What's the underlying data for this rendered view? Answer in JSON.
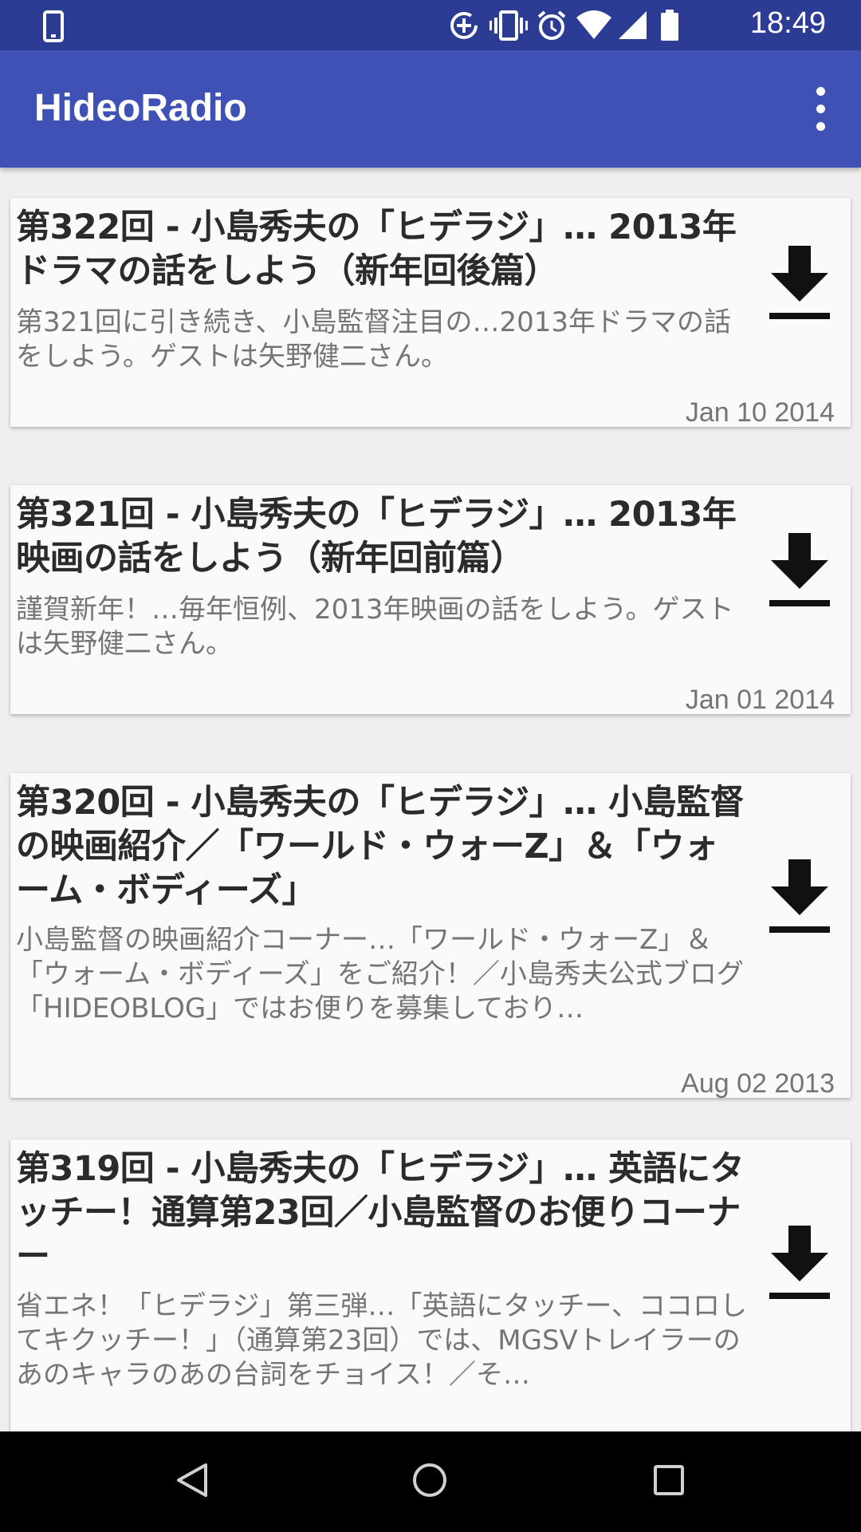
{
  "status_bar": {
    "time": "18:49",
    "icons": [
      "phone-icon",
      "data-saver-icon",
      "vibrate-icon",
      "alarm-icon",
      "wifi-icon",
      "signal-icon",
      "battery-icon"
    ]
  },
  "app_bar": {
    "title": "HideoRadio",
    "overflow_icon": "more-vert-icon"
  },
  "episodes": [
    {
      "title": "第322回 - 小島秀夫の「ヒデラジ」… 2013年ドラマの話をしよう（新年回後篇）",
      "description": "第321回に引き続き、小島監督注目の…2013年ドラマの話をしよう。ゲストは矢野健二さん。",
      "date": "Jan 10 2014",
      "action_icon": "download-icon"
    },
    {
      "title": "第321回 - 小島秀夫の「ヒデラジ」… 2013年映画の話をしよう（新年回前篇）",
      "description": "謹賀新年！…毎年恒例、2013年映画の話をしよう。ゲストは矢野健二さん。",
      "date": "Jan 01 2014",
      "action_icon": "download-icon"
    },
    {
      "title": "第320回 - 小島秀夫の「ヒデラジ」… 小島監督の映画紹介／「ワールド・ウォーZ」＆「ウォーム・ボディーズ」",
      "description": "小島監督の映画紹介コーナー…「ワールド・ウォーZ」＆「ウォーム・ボディーズ」をご紹介！／小島秀夫公式ブログ「HIDEOBLOG」ではお便りを募集しており…",
      "date": "Aug 02 2013",
      "action_icon": "download-icon"
    },
    {
      "title": "第319回 - 小島秀夫の「ヒデラジ」… 英語にタッチー！通算第23回／小島監督のお便りコーナー",
      "description": "省エネ！「ヒデラジ」第三弾…「英語にタッチー、ココロしてキクッチー！」（通算第23回）では、MGSVトレイラーのあのキャラのあの台詞をチョイス！／そ…",
      "date": "",
      "action_icon": "download-icon"
    }
  ],
  "nav_bar": {
    "icons": [
      "back-icon",
      "home-icon",
      "recents-icon"
    ]
  }
}
